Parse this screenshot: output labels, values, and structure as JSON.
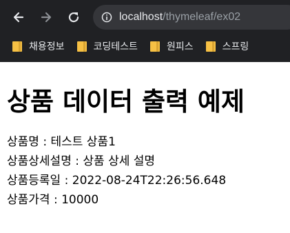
{
  "browser": {
    "url_host": "localhost",
    "url_path": "/thymeleaf/ex02",
    "bookmarks": [
      {
        "label": "채용정보"
      },
      {
        "label": "코딩테스트"
      },
      {
        "label": "원피스"
      },
      {
        "label": "스프링"
      }
    ]
  },
  "page": {
    "title": "상품 데이터 출력 예제",
    "fields": [
      {
        "label": "상품명",
        "value": "테스트 상품1"
      },
      {
        "label": "상품상세설명",
        "value": "상품 상세 설명"
      },
      {
        "label": "상품등록일",
        "value": "2022-08-24T22:26:56.648"
      },
      {
        "label": "상품가격",
        "value": "10000"
      }
    ],
    "separator": " : "
  }
}
